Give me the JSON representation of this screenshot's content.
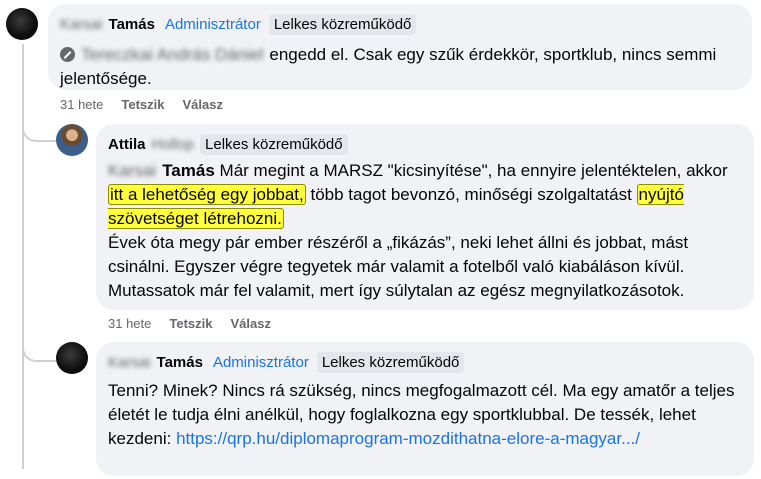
{
  "comments": [
    {
      "blurred_first": "Karsai",
      "name": "Tamás",
      "role": "Adminisztrátor",
      "badge": "Lelkes közreműködő",
      "mention_blurred": "Tereczkai András Dániel",
      "text": "engedd el. Csak egy szűk érdekkör, sportklub, nincs semmi jelentősége.",
      "time": "31 hete",
      "like": "Tetszik",
      "reply": "Válasz"
    },
    {
      "name": "Attila",
      "blurred_last": "Hollop",
      "badge": "Lelkes közreműködő",
      "mention_blurred": "Karsai",
      "mention_name": "Tamás",
      "text_before": "Már megint a MARSZ \"kicsinyítése\", ha ennyire jelentéktelen, akkor",
      "highlight_1": "itt a lehetőség egy jobbat,",
      "text_middle": "több tagot bevonzó, minőségi szolgaltatást",
      "highlight_2": "nyújtó szövetséget létrehozni.",
      "text_after": "Évek óta megy pár ember részéről a „fikázás”, neki lehet állni és jobbat, mást csinálni. Egyszer végre tegyetek már valamit a fotelből való kiabáláson kívül. Mutassatok már fel valamit, mert így súlytalan az egész megnyilatkozásotok.",
      "time": "31 hete",
      "like": "Tetszik",
      "reply": "Válasz"
    },
    {
      "blurred_first": "Karsai",
      "name": "Tamás",
      "role": "Adminisztrátor",
      "badge": "Lelkes közreműködő",
      "text": "Tenni? Minek? Nincs rá szükség, nincs megfogalmazott cél. Ma egy amatőr a teljes életét le tudja élni anélkül, hogy foglalkozna egy sportklubbal. De tessék, lehet kezdeni:",
      "link": "https://qrp.hu/diplomaprogram-mozdithatna-elore-a-magyar.../"
    }
  ],
  "icons": [
    "blocked-user-icon"
  ],
  "colors": {
    "accent": "#1b74e4",
    "bubble": "#f0f2f5",
    "highlight": "#ffff3b"
  }
}
